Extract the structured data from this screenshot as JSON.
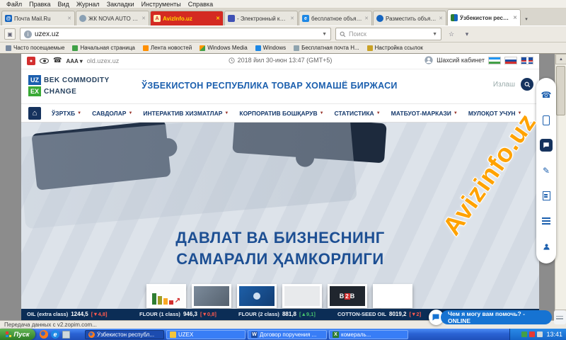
{
  "browser": {
    "menu": [
      "Файл",
      "Правка",
      "Вид",
      "Журнал",
      "Закладки",
      "Инструменты",
      "Справка"
    ],
    "tabs": [
      {
        "label": "Почта Mail.Ru"
      },
      {
        "label": "ЖК NOVA AUTO PAR..."
      },
      {
        "label": "AvizInfo.uz"
      },
      {
        "label": "- Электронный ката..."
      },
      {
        "label": "бесплатное объявл..."
      },
      {
        "label": "Разместить объявл..."
      },
      {
        "label": "Ўзбекистон республ..."
      }
    ],
    "close_glyph": "✕",
    "address": {
      "url": "uzex.uz",
      "search_placeholder": "Поиск"
    },
    "bookmarks": [
      "Часто посещаемые",
      "Начальная страница",
      "Лента новостей",
      "Windows Media",
      "Windows",
      "Бесплатная почта Н...",
      "Настройка ссылок"
    ],
    "status": "Передача данных с v2.zopim.com..."
  },
  "page": {
    "topbar": {
      "aaa": "AAA",
      "old_link": "old.uzex.uz",
      "datetime": "2018 йил 30-июн 13:47 (GMT+5)",
      "cabinet": "Шахсий кабинет"
    },
    "header": {
      "logo": {
        "uz": "UZ",
        "bek": "BEK COMMODITY",
        "ex": "EX",
        "change": "CHANGE"
      },
      "title": "ЎЗБЕКИСТОН РЕСПУБЛИКА ТОВАР ХОМАШЁ БИРЖАСИ",
      "search": "Излаш"
    },
    "nav": {
      "home_glyph": "⌂",
      "items": [
        "ЎЗРТХБ",
        "САВДОЛАР",
        "ИНТЕРАКТИВ ХИЗМАТЛАР",
        "КОРПОРАТИВ БОШҚАРУВ",
        "СТАТИСТИКА",
        "МАТБУОТ-МАРКАЗИ",
        "МУЛОҚОТ УЧУН"
      ]
    },
    "hero": {
      "line1": "ДАВЛАТ ВА БИЗНЕСНИНГ",
      "line2": "САМАРАЛИ ҲАМКОРЛИГИ"
    },
    "gallery": {
      "b2b_left": "B",
      "b2b_mid": "2",
      "b2b_right": "B"
    },
    "ticker": {
      "items": [
        {
          "name": "OIL (extra class)",
          "value": "1244,5",
          "change": "[▼4,8]",
          "dir": "down"
        },
        {
          "name": "FLOUR (1 class)",
          "value": "946,3",
          "change": "[▼0,8]",
          "dir": "down"
        },
        {
          "name": "FLOUR (2 class)",
          "value": "881,8",
          "change": "[▲9,1]",
          "dir": "up"
        },
        {
          "name": "COTTON-SEED OIL",
          "value": "8019,2",
          "change": "[▼2]",
          "dir": "down"
        }
      ]
    },
    "chat": {
      "text": "Чем я могу вам помочь? - ONLINE"
    }
  },
  "taskbar": {
    "start": "Пуск",
    "windows": [
      {
        "label": "Ўзбекистон республ..."
      },
      {
        "label": "UZEX"
      },
      {
        "label": "Договор поручения ..."
      },
      {
        "label": "комераль..."
      }
    ],
    "time": "13:41"
  },
  "watermark": "Avizinfo.uz",
  "colors": {
    "accent_blue": "#1b5fae",
    "accent_green": "#39a935",
    "navy": "#16335e",
    "ticker_bg": "#0b2d56",
    "down_red": "#ff5a4e",
    "up_green": "#46c06e",
    "taskbar_blue": "#2b63d4",
    "start_green": "#2e7d27",
    "watermark_orange": "#ffa200"
  }
}
